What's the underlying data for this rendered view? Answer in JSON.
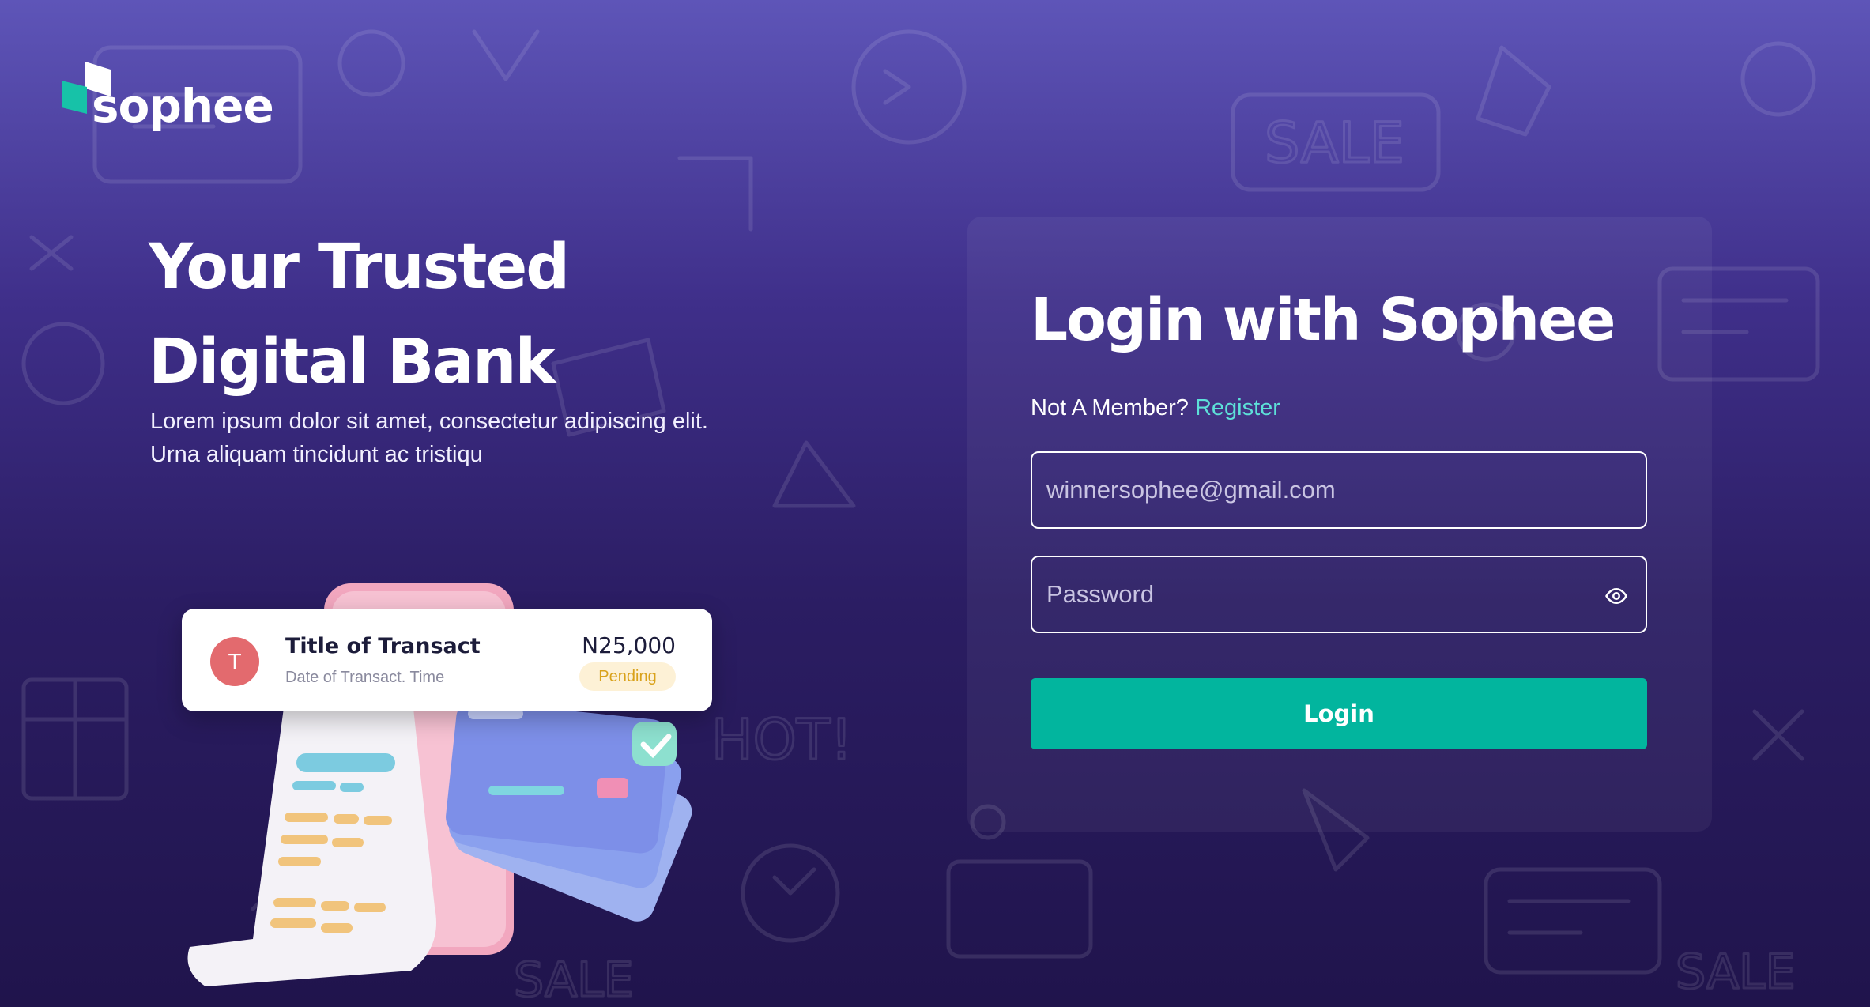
{
  "brand": {
    "logo_text": "sophee",
    "logo_colors": {
      "teal": "#17c2a8",
      "white": "#ffffff"
    }
  },
  "hero": {
    "title": "Your Trusted Digital Bank",
    "subtitle": "Lorem ipsum dolor sit amet, consectetur adipiscing elit. Urna aliquam tincidunt ac tristiqu"
  },
  "transaction_card": {
    "avatar_letter": "T",
    "title": "Title of Transact",
    "date": "Date of Transact. Time",
    "amount": "N25,000",
    "status": "Pending"
  },
  "login": {
    "title": "Login with Sophee",
    "member_prompt": "Not A Member?",
    "register_label": "Register",
    "email": {
      "placeholder": "winnersophee@gmail.com"
    },
    "password": {
      "placeholder": "Password",
      "toggle_icon": "eye-icon"
    },
    "button_label": "Login"
  },
  "colors": {
    "primary_button": "#02b59e",
    "link": "#5de0d8",
    "background_top": "#5e55b8",
    "background_bottom": "#20144c",
    "pending_badge_text": "#d9a21b",
    "avatar": "#e36a6e"
  }
}
